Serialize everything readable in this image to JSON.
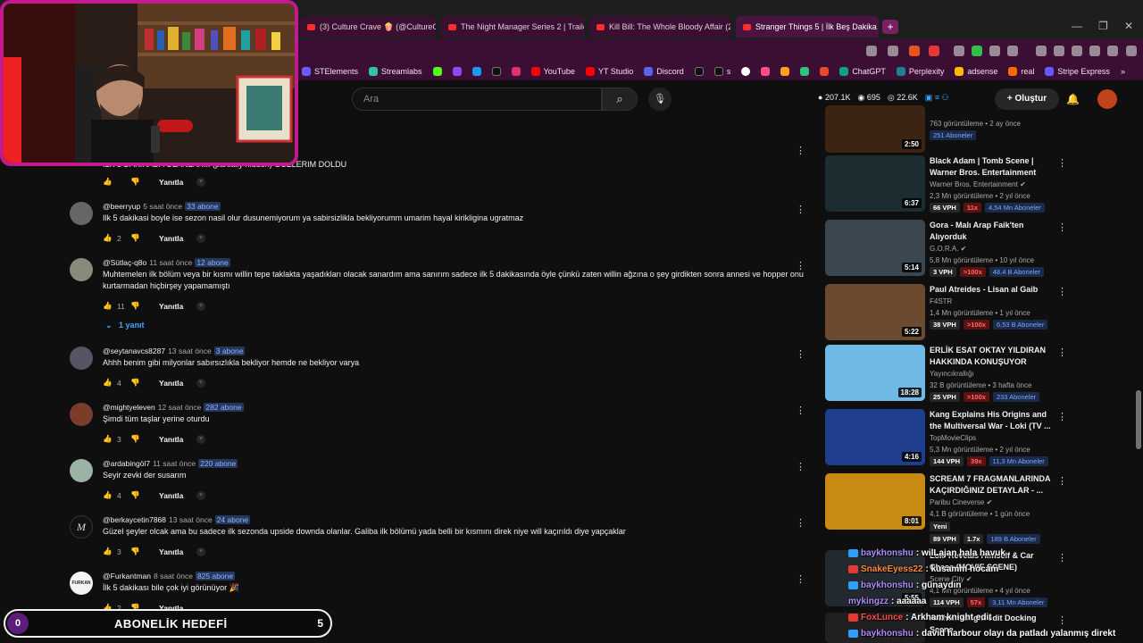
{
  "browser": {
    "tabs": [
      {
        "label": "(3) Culture Crave 🍿 (@CultureCrav..."
      },
      {
        "label": "The Night Manager Series 2 | Trailer"
      },
      {
        "label": "Kill Bill: The Whole Bloody Affair (20..."
      },
      {
        "label": "Stranger Things 5 | İlk Beş Dakika",
        "active": true
      }
    ],
    "new_tab": "+",
    "window_controls": [
      "—",
      "❐",
      "✕"
    ],
    "bookmarks": [
      {
        "label": "STElements",
        "color": "#6b5bff"
      },
      {
        "label": "Streamlabs",
        "color": "#31c3a2"
      },
      {
        "label": "",
        "color": "#53fc18"
      },
      {
        "label": "",
        "color": "#9146ff"
      },
      {
        "label": "",
        "color": "#1d9bf0"
      },
      {
        "label": "",
        "color": "#000000"
      },
      {
        "label": "",
        "color": "#e1306c"
      },
      {
        "label": "YouTube",
        "color": "#ff0000"
      },
      {
        "label": "YT Studio",
        "color": "#ff0000"
      },
      {
        "label": "Discord",
        "color": "#5865f2"
      },
      {
        "label": "s",
        "color": "#000000"
      },
      {
        "label": "",
        "color": "#ffffff"
      },
      {
        "label": "",
        "color": "#ff4d88"
      },
      {
        "label": "",
        "color": "#ff9f1c"
      },
      {
        "label": "",
        "color": "#2ec27e"
      },
      {
        "label": "",
        "color": "#e84a27"
      },
      {
        "label": "ChatGPT",
        "color": "#10a37f"
      },
      {
        "label": "Perplexity",
        "color": "#20808d"
      },
      {
        "label": "adsense",
        "color": "#fbbc04"
      },
      {
        "label": "real",
        "color": "#ff6a00"
      },
      {
        "label": "Stripe Express",
        "color": "#635bff"
      }
    ]
  },
  "header": {
    "search_placeholder": "Ara",
    "search_icon": "search-icon",
    "mic_icon": "mic-icon",
    "stats": {
      "views": "207.1K",
      "likes": "695",
      "subs": "22.6K"
    },
    "create_label": "Oluştur",
    "create_plus": "+"
  },
  "comments": [
    {
      "user": "",
      "time": "",
      "subs": "",
      "text": "ILK 5 DAKIKADA OLANLAR... (partially hidden) GOZLERIM DOLDU",
      "likes": "",
      "reply": "Yanıtla"
    },
    {
      "user": "@beerryup",
      "time": "5 saat önce",
      "subs": "33 abone",
      "text": "Ilk 5 dakikasi boyle ise sezon nasil olur dusunemiyorum ya sabirsizlikla bekliyorumm umarim hayal kirikligina ugratmaz",
      "likes": "2",
      "reply": "Yanıtla"
    },
    {
      "user": "@Sütlaç-q8o",
      "time": "11 saat önce",
      "subs": "12 abone",
      "text": "Muhtemelen ilk bölüm veya bir kısmı willin tepe taklakta yaşadıkları olacak sanardım ama sanırım sadece ilk 5 dakikasında öyle çünkü zaten willin ağzına o şey girdikten sonra annesi ve hopper onu kurtarmadan hiçbirşey yapamamıştı",
      "likes": "11",
      "reply": "Yanıtla",
      "replies": "1 yanıt"
    },
    {
      "user": "@seytanavcs8287",
      "time": "13 saat önce",
      "subs": "3 abone",
      "text": "Ahhh benim gibi milyonlar sabırsızlıkla bekliyor hemde ne bekliyor varya",
      "likes": "4",
      "reply": "Yanıtla"
    },
    {
      "user": "@mightyeleven",
      "time": "12 saat önce",
      "subs": "282 abone",
      "text": "Şimdi tüm taşlar yerine oturdu",
      "likes": "3",
      "reply": "Yanıtla"
    },
    {
      "user": "@ardabingöl7",
      "time": "11 saat önce",
      "subs": "220 abone",
      "text": "Seyir zevki der susarım",
      "likes": "4",
      "reply": "Yanıtla"
    },
    {
      "user": "@berkaycetin7868",
      "time": "13 saat önce",
      "subs": "24 abone",
      "text": "Güzel şeyler olcak ama bu sadece ilk sezonda upside downda olanlar. Galiba ilk bölümü yada belli bir kısmını direk niye will kaçırıldı diye yapçaklar",
      "likes": "3",
      "reply": "Yanıtla"
    },
    {
      "user": "@Furkantman",
      "time": "8 saat önce",
      "subs": "825 abone",
      "text": "İlk 5 dakikası bile çok iyi görünüyor 🎉",
      "likes": "2",
      "reply": "Yanıtla"
    }
  ],
  "sidebar": [
    {
      "title": "",
      "channel": "",
      "views": "763 görüntüleme • 2 ay önce",
      "tags": [],
      "subs": "251 Aboneler",
      "duration": "2:50",
      "thumb": "#3b2414"
    },
    {
      "title": "Black Adam | Tomb Scene | Warner Bros. Entertainment",
      "channel": "Warner Bros. Entertainment ✔",
      "views": "2,3 Mn görüntüleme • 2 yıl önce",
      "tags": [
        {
          "t": "66 VPH",
          "c": ""
        },
        {
          "t": "11x",
          "c": "red"
        }
      ],
      "subs": "4,54 Mn Aboneler",
      "duration": "6:37",
      "thumb": "#1d2e32"
    },
    {
      "title": "Gora - Malı Arap Faik'ten Alıyorduk",
      "channel": "G.O.R.A. ✔",
      "views": "5,8 Mn görüntüleme • 10 yıl önce",
      "tags": [
        {
          "t": "3 VPH",
          "c": ""
        },
        {
          "t": ">100x",
          "c": "red"
        }
      ],
      "subs": "48,4 B Aboneler",
      "duration": "5:14",
      "thumb": "#3a4650"
    },
    {
      "title": "Paul Atreides - Lisan al Gaib",
      "channel": "F4STR",
      "views": "1,4 Mn görüntüleme • 1 yıl önce",
      "tags": [
        {
          "t": "38 VPH",
          "c": ""
        },
        {
          "t": ">100x",
          "c": "red"
        }
      ],
      "subs": "6,53 B Aboneler",
      "duration": "5:22",
      "thumb": "#6b4a2f"
    },
    {
      "title": "ERLİK ESAT OKTAY YILDIRAN HAKKINDA KONUŞUYOR",
      "channel": "Yayıncıkrallığı",
      "views": "32 B görüntüleme • 3 hafta önce",
      "tags": [
        {
          "t": "25 VPH",
          "c": ""
        },
        {
          "t": ">100x",
          "c": "red"
        }
      ],
      "subs": "233 Aboneler",
      "duration": "18:28",
      "thumb": "#6fb9e6"
    },
    {
      "title": "Kang Explains His Origins and the Multiversal War - Loki (TV ...",
      "channel": "TopMovieClips",
      "views": "5,3 Mn görüntüleme • 2 yıl önce",
      "tags": [
        {
          "t": "144 VPH",
          "c": ""
        },
        {
          "t": "39x",
          "c": "red"
        }
      ],
      "subs": "11,3 Mn Aboneler",
      "duration": "4:16",
      "thumb": "#1f3f8e"
    },
    {
      "title": "SCREAM 7 FRAGMANLARINDA KAÇIRDIĞINIZ DETAYLAR - ...",
      "channel": "Paribu Cineverse ✔",
      "views": "4,1 B görüntüleme • 1 gün önce",
      "extra": "Yeni",
      "tags": [
        {
          "t": "89 VPH",
          "c": ""
        },
        {
          "t": "1.7x",
          "c": ""
        }
      ],
      "subs": "189 B Aboneler",
      "duration": "8:01",
      "thumb": "#c98a12"
    },
    {
      "title": "Loki Reveals Himself & Car Chase (MOVIE SCENE)",
      "channel": "Scene City ✔",
      "views": "4,1 Mn görüntüleme • 4 yıl önce",
      "tags": [
        {
          "t": "114 VPH",
          "c": ""
        },
        {
          "t": "57x",
          "c": "red"
        }
      ],
      "subs": "3,11 Mn Aboneler",
      "duration": "5:55",
      "thumb": "#222a30"
    },
    {
      "title": "Arkham knight edit Docking Scene",
      "channel": "",
      "views": "",
      "tags": [],
      "subs": "",
      "duration": "",
      "thumb": "#202020"
    }
  ],
  "overlay": {
    "goal_title": "ABONELİK HEDEFİ",
    "goal_current": "0",
    "goal_target": "5",
    "chat": [
      {
        "user": "baykhonshu",
        "color": "#b08cff",
        "msg": ": wilLajan hala havuk"
      },
      {
        "user": "SnakeEyess22",
        "color": "#ff8a3d",
        "msg": ": kusamm hocam"
      },
      {
        "user": "baykhonshu",
        "color": "#b08cff",
        "msg": ": günaydın"
      },
      {
        "user": "mykingzz",
        "color": "#b08cff",
        "msg": ": aaaaaa"
      },
      {
        "user": "FoxLunce",
        "color": "#ff4d4d",
        "msg": ": Arkham knight edit"
      },
      {
        "user": "baykhonshu",
        "color": "#b08cff",
        "msg": ": david harbour olayı da patladı yalanmış direkt"
      }
    ]
  }
}
